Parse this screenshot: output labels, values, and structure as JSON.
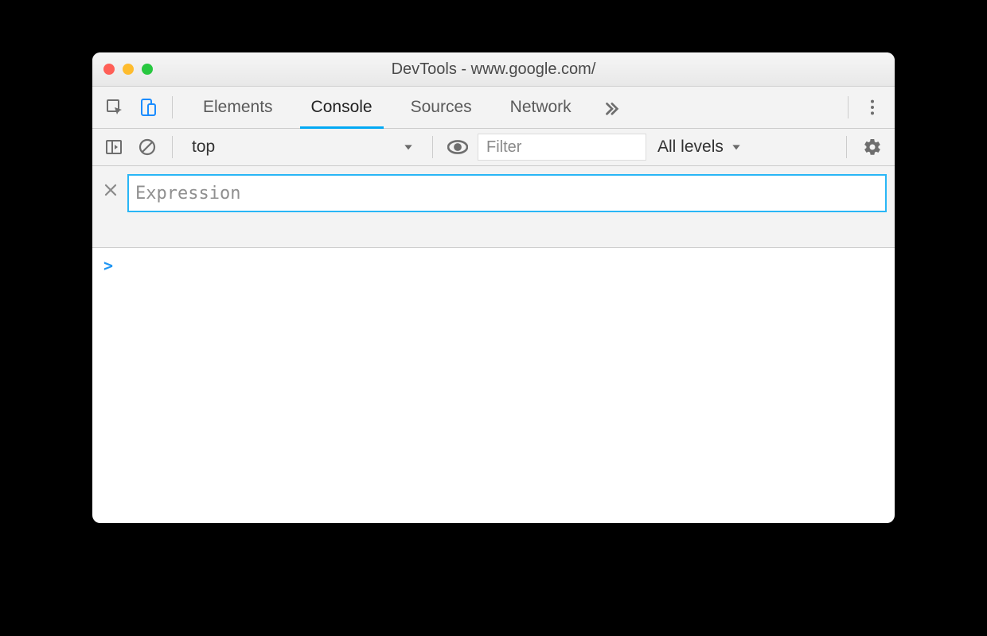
{
  "window": {
    "title": "DevTools - www.google.com/"
  },
  "tabs": {
    "items": [
      "Elements",
      "Console",
      "Sources",
      "Network"
    ],
    "active": "Console"
  },
  "consoleToolbar": {
    "context": "top",
    "filter_placeholder": "Filter",
    "levels_label": "All levels"
  },
  "liveExpression": {
    "placeholder": "Expression",
    "value": ""
  },
  "prompt": {
    "symbol": ">"
  }
}
